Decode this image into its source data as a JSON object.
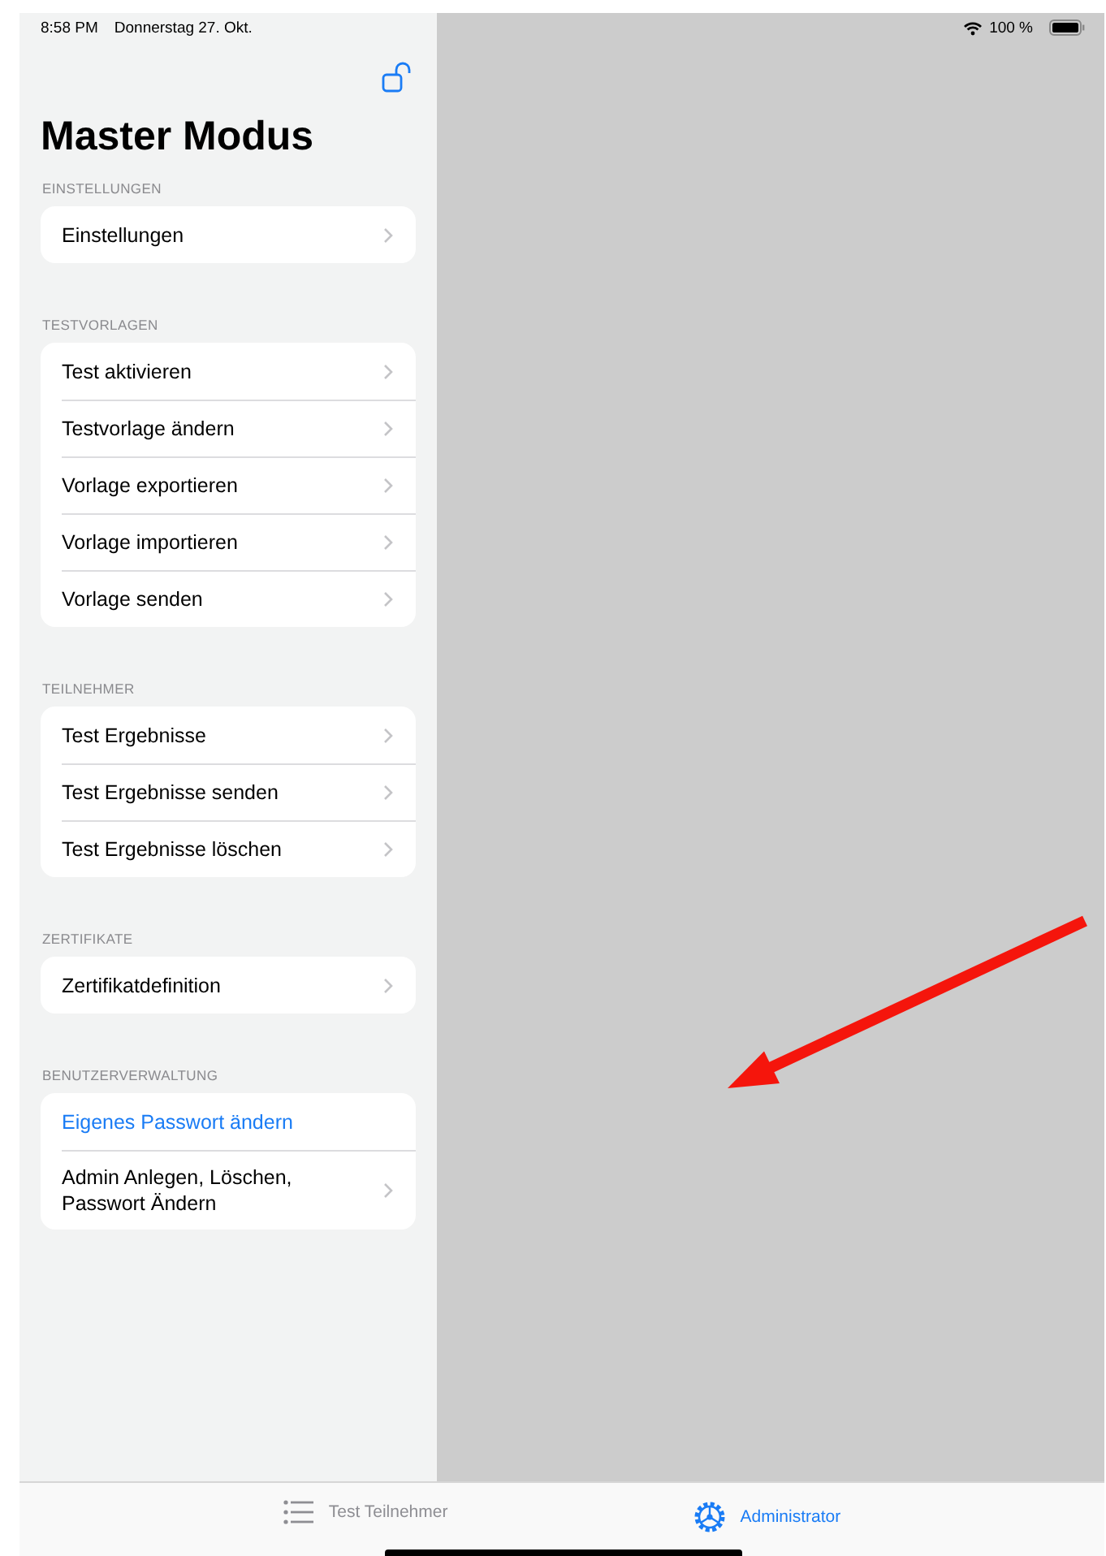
{
  "status_bar": {
    "time": "8:58 PM",
    "date": "Donnerstag 27. Okt.",
    "battery": "100 %"
  },
  "sidebar": {
    "title": "Master Modus",
    "locked": false,
    "sections": [
      {
        "header": "EINSTELLUNGEN",
        "items": [
          {
            "label": "Einstellungen",
            "kind": "nav"
          }
        ]
      },
      {
        "header": "TESTVORLAGEN",
        "items": [
          {
            "label": "Test aktivieren",
            "kind": "nav"
          },
          {
            "label": "Testvorlage ändern",
            "kind": "nav"
          },
          {
            "label": "Vorlage exportieren",
            "kind": "nav"
          },
          {
            "label": "Vorlage importieren",
            "kind": "nav"
          },
          {
            "label": "Vorlage senden",
            "kind": "nav"
          }
        ]
      },
      {
        "header": "TEILNEHMER",
        "items": [
          {
            "label": "Test Ergebnisse",
            "kind": "nav"
          },
          {
            "label": "Test Ergebnisse senden",
            "kind": "nav"
          },
          {
            "label": "Test Ergebnisse löschen",
            "kind": "nav"
          }
        ]
      },
      {
        "header": "ZERTIFIKATE",
        "items": [
          {
            "label": "Zertifikatdefinition",
            "kind": "nav"
          }
        ]
      },
      {
        "header": "BENUTZERVERWALTUNG",
        "items": [
          {
            "label": "Eigenes Passwort ändern",
            "kind": "action"
          },
          {
            "label": "Admin Anlegen, Löschen,\nPasswort Ändern",
            "kind": "nav"
          }
        ]
      }
    ]
  },
  "tab_bar": {
    "tabs": [
      {
        "label": "Test Teilnehmer",
        "kind": "list",
        "selected": false
      },
      {
        "label": "Administrator",
        "kind": "gear",
        "selected": true
      }
    ]
  }
}
